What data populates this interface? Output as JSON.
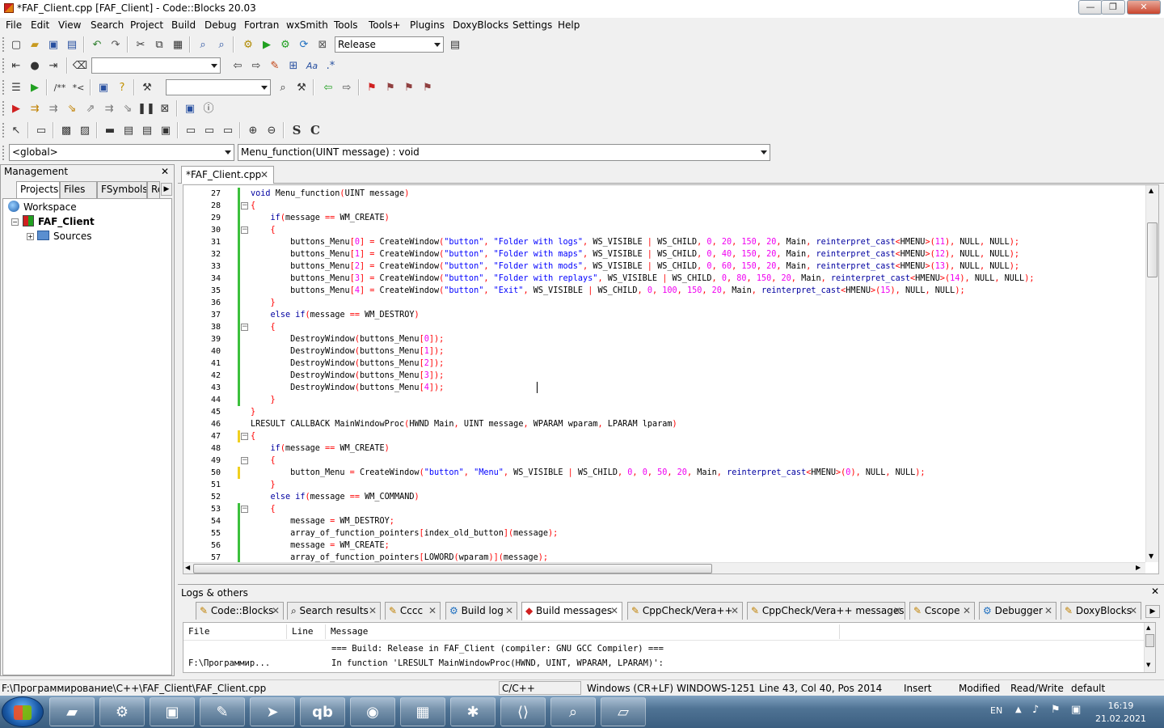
{
  "window": {
    "title": "*FAF_Client.cpp [FAF_Client] - Code::Blocks 20.03",
    "min_label": "—",
    "max_label": "❐",
    "close_label": "✕"
  },
  "menubar": [
    "File",
    "Edit",
    "View",
    "Search",
    "Project",
    "Build",
    "Debug",
    "Fortran",
    "wxSmith",
    "Tools",
    "Tools+",
    "Plugins",
    "DoxyBlocks",
    "Settings",
    "Help"
  ],
  "toolbar": {
    "build_target": "Release"
  },
  "scope": {
    "global": "<global>",
    "function": "Menu_function(UINT message) : void"
  },
  "management": {
    "title": "Management",
    "close": "✕",
    "tabs": [
      "Projects",
      "Files",
      "FSymbols",
      "Re"
    ],
    "tree": {
      "workspace": "Workspace",
      "project": "FAF_Client",
      "folder": "Sources"
    }
  },
  "editor": {
    "tab_label": "*FAF_Client.cpp",
    "tab_close": "✕",
    "lines": [
      {
        "n": "27",
        "t": "void Menu_function(UINT message)"
      },
      {
        "n": "28",
        "t": "{"
      },
      {
        "n": "29",
        "t": "    if(message == WM_CREATE)"
      },
      {
        "n": "30",
        "t": "    {"
      },
      {
        "n": "31",
        "t": "        buttons_Menu[0] = CreateWindow(\"button\", \"Folder with logs\", WS_VISIBLE | WS_CHILD, 0, 20, 150, 20, Main, reinterpret_cast<HMENU>(11), NULL, NULL);"
      },
      {
        "n": "32",
        "t": "        buttons_Menu[1] = CreateWindow(\"button\", \"Folder with maps\", WS_VISIBLE | WS_CHILD, 0, 40, 150, 20, Main, reinterpret_cast<HMENU>(12), NULL, NULL);"
      },
      {
        "n": "33",
        "t": "        buttons_Menu[2] = CreateWindow(\"button\", \"Folder with mods\", WS_VISIBLE | WS_CHILD, 0, 60, 150, 20, Main, reinterpret_cast<HMENU>(13), NULL, NULL);"
      },
      {
        "n": "34",
        "t": "        buttons_Menu[3] = CreateWindow(\"button\", \"Folder with replays\", WS_VISIBLE | WS_CHILD, 0, 80, 150, 20, Main, reinterpret_cast<HMENU>(14), NULL, NULL);"
      },
      {
        "n": "35",
        "t": "        buttons_Menu[4] = CreateWindow(\"button\", \"Exit\", WS_VISIBLE | WS_CHILD, 0, 100, 150, 20, Main, reinterpret_cast<HMENU>(15), NULL, NULL);"
      },
      {
        "n": "36",
        "t": "    }"
      },
      {
        "n": "37",
        "t": "    else if(message == WM_DESTROY)"
      },
      {
        "n": "38",
        "t": "    {"
      },
      {
        "n": "39",
        "t": "        DestroyWindow(buttons_Menu[0]);"
      },
      {
        "n": "40",
        "t": "        DestroyWindow(buttons_Menu[1]);"
      },
      {
        "n": "41",
        "t": "        DestroyWindow(buttons_Menu[2]);"
      },
      {
        "n": "42",
        "t": "        DestroyWindow(buttons_Menu[3]);"
      },
      {
        "n": "43",
        "t": "        DestroyWindow(buttons_Menu[4]);"
      },
      {
        "n": "44",
        "t": "    }"
      },
      {
        "n": "45",
        "t": "}"
      },
      {
        "n": "46",
        "t": "LRESULT CALLBACK MainWindowProc(HWND Main, UINT message, WPARAM wparam, LPARAM lparam)"
      },
      {
        "n": "47",
        "t": "{"
      },
      {
        "n": "48",
        "t": "    if(message == WM_CREATE)"
      },
      {
        "n": "49",
        "t": "    {"
      },
      {
        "n": "50",
        "t": "        button_Menu = CreateWindow(\"button\", \"Menu\", WS_VISIBLE | WS_CHILD, 0, 0, 50, 20, Main, reinterpret_cast<HMENU>(0), NULL, NULL);"
      },
      {
        "n": "51",
        "t": "    }"
      },
      {
        "n": "52",
        "t": "    else if(message == WM_COMMAND)"
      },
      {
        "n": "53",
        "t": "    {"
      },
      {
        "n": "54",
        "t": "        message = WM_DESTROY;"
      },
      {
        "n": "55",
        "t": "        array_of_function_pointers[index_old_button](message);"
      },
      {
        "n": "56",
        "t": "        message = WM_CREATE;"
      },
      {
        "n": "57",
        "t": "        array_of_function_pointers[LOWORD(wparam)](message);"
      }
    ]
  },
  "logs": {
    "title": "Logs & others",
    "close": "✕",
    "tabs": [
      "Code::Blocks",
      "Search results",
      "Cccc",
      "Build log",
      "Build messages",
      "CppCheck/Vera++",
      "CppCheck/Vera++ messages",
      "Cscope",
      "Debugger",
      "DoxyBlocks"
    ],
    "columns": [
      "File",
      "Line",
      "Message"
    ],
    "rows": [
      {
        "file": "",
        "line": "",
        "message": "=== Build: Release in FAF_Client (compiler: GNU GCC Compiler) ==="
      },
      {
        "file": "F:\\Программир...",
        "line": "",
        "message": "In function 'LRESULT MainWindowProc(HWND, UINT, WPARAM, LPARAM)':"
      }
    ]
  },
  "status": {
    "path": "F:\\Программирование\\C++\\FAF_Client\\FAF_Client.cpp",
    "lang": "C/C++",
    "eol": "Windows (CR+LF)",
    "encoding": "WINDOWS-1251",
    "position": "Line 43, Col 40, Pos 2014",
    "mode": "Insert",
    "modified": "Modified",
    "access": "Read/Write",
    "theme": "default"
  },
  "taskbar": {
    "lang": "EN",
    "time": "16:19",
    "date": "21.02.2021"
  }
}
